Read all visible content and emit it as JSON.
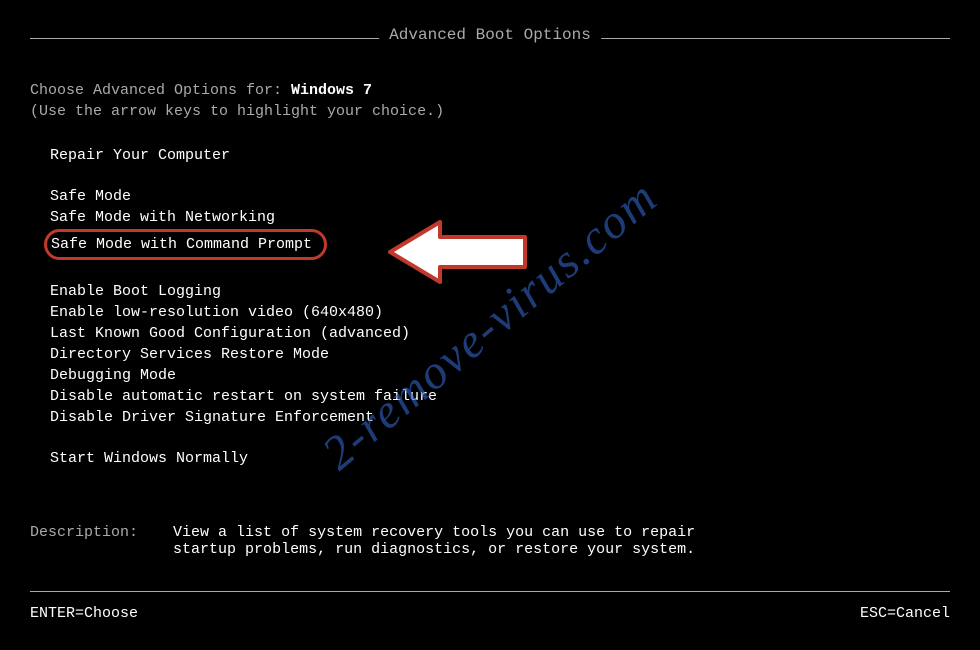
{
  "title": "Advanced Boot Options",
  "header": {
    "prefix": "Choose Advanced Options for: ",
    "os": "Windows 7",
    "instruction": "(Use the arrow keys to highlight your choice.)"
  },
  "menu": {
    "group1": [
      "Repair Your Computer"
    ],
    "group2": [
      "Safe Mode",
      "Safe Mode with Networking",
      "Safe Mode with Command Prompt"
    ],
    "group3": [
      "Enable Boot Logging",
      "Enable low-resolution video (640x480)",
      "Last Known Good Configuration (advanced)",
      "Directory Services Restore Mode",
      "Debugging Mode",
      "Disable automatic restart on system failure",
      "Disable Driver Signature Enforcement"
    ],
    "group4": [
      "Start Windows Normally"
    ]
  },
  "description": {
    "label": "Description:",
    "text_line1": "View a list of system recovery tools you can use to repair",
    "text_line2": "startup problems, run diagnostics, or restore your system."
  },
  "footer": {
    "left": "ENTER=Choose",
    "right": "ESC=Cancel"
  },
  "watermark": "2-remove-virus.com"
}
